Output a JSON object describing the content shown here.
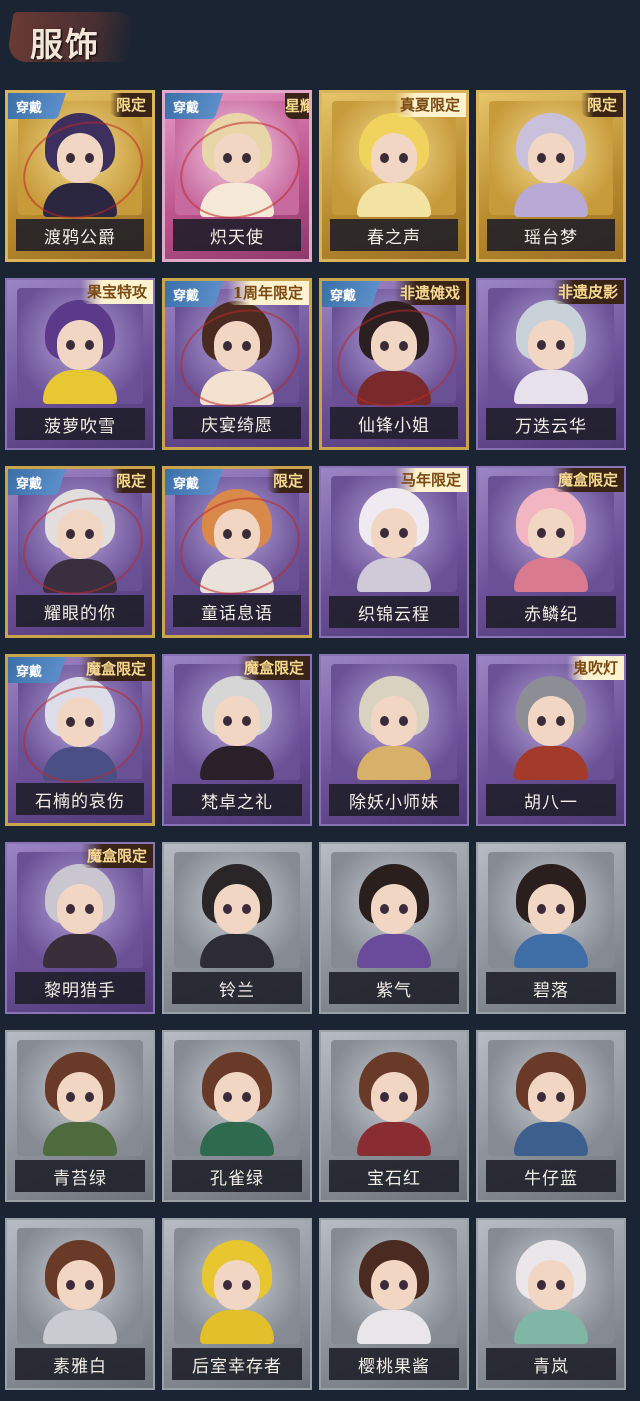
{
  "header": {
    "title": "服饰"
  },
  "badge_text": "穿戴",
  "cards": [
    {
      "name": "渡鸦公爵",
      "rarity": "gold",
      "worn": true,
      "tag": "限定",
      "tag_style": "h",
      "hair": "#3d2f5e",
      "body": "#2b2740"
    },
    {
      "name": "炽天使",
      "rarity": "pink",
      "worn": true,
      "tag": "星耀限定",
      "tag_style": "v",
      "hair": "#e9d6a8",
      "body": "#f6e8d6"
    },
    {
      "name": "春之声",
      "rarity": "gold",
      "worn": false,
      "tag": "真夏限定",
      "tag_style": "light",
      "hair": "#f0d35c",
      "body": "#f3e3a2"
    },
    {
      "name": "瑶台梦",
      "rarity": "gold",
      "worn": false,
      "tag": "限定",
      "tag_style": "h",
      "hair": "#c9c1dc",
      "body": "#b9a9d6"
    },
    {
      "name": "菠萝吹雪",
      "rarity": "purple",
      "worn": false,
      "tag": "果宝特攻",
      "tag_style": "light",
      "hair": "#5b3a8a",
      "body": "#e8c832"
    },
    {
      "name": "庆宴绮愿",
      "rarity": "purple",
      "worn": true,
      "tag": "1周年限定",
      "tag_style": "light",
      "hair": "#4a2b22",
      "body": "#f2e2cf"
    },
    {
      "name": "仙锋小姐",
      "rarity": "purple",
      "worn": true,
      "tag": "非遗傩戏",
      "tag_style": "h",
      "hair": "#2b1f22",
      "body": "#7a2a2a"
    },
    {
      "name": "万迭云华",
      "rarity": "purple",
      "worn": false,
      "tag": "非遗皮影",
      "tag_style": "h",
      "hair": "#c9d2d8",
      "body": "#e6e1ea"
    },
    {
      "name": "耀眼的你",
      "rarity": "purple",
      "worn": true,
      "tag": "限定",
      "tag_style": "h",
      "hair": "#e3dede",
      "body": "#3a2f3f"
    },
    {
      "name": "童话息语",
      "rarity": "purple",
      "worn": true,
      "tag": "限定",
      "tag_style": "h",
      "hair": "#d98a4a",
      "body": "#e9e1da"
    },
    {
      "name": "织锦云程",
      "rarity": "purple",
      "worn": false,
      "tag": "马年限定",
      "tag_style": "light",
      "hair": "#efeaf2",
      "body": "#d0cad8"
    },
    {
      "name": "赤鳞纪",
      "rarity": "purple",
      "worn": false,
      "tag": "魔盒限定",
      "tag_style": "h",
      "hair": "#f2b6c2",
      "body": "#d97a8e"
    },
    {
      "name": "石楠的哀伤",
      "rarity": "purple",
      "worn": true,
      "tag": "魔盒限定",
      "tag_style": "h",
      "hair": "#dcdde8",
      "body": "#4a4f86"
    },
    {
      "name": "梵卓之礼",
      "rarity": "purple",
      "worn": false,
      "tag": "魔盒限定",
      "tag_style": "h",
      "hair": "#d6d6d6",
      "body": "#2b1f2a"
    },
    {
      "name": "除妖小师妹",
      "rarity": "purple",
      "worn": false,
      "tag": "",
      "tag_style": "h",
      "hair": "#d9d2c0",
      "body": "#d7b06a"
    },
    {
      "name": "胡八一",
      "rarity": "purple",
      "worn": false,
      "tag": "鬼吹灯",
      "tag_style": "light",
      "hair": "#8d8d95",
      "body": "#a33a2a"
    },
    {
      "name": "黎明猎手",
      "rarity": "purple",
      "worn": false,
      "tag": "魔盒限定",
      "tag_style": "h",
      "hair": "#c9c6d0",
      "body": "#3a2d3a"
    },
    {
      "name": "铃兰",
      "rarity": "grey",
      "worn": false,
      "tag": "",
      "tag_style": "h",
      "hair": "#2a2526",
      "body": "#2d2b35"
    },
    {
      "name": "紫气",
      "rarity": "grey",
      "worn": false,
      "tag": "",
      "tag_style": "h",
      "hair": "#2a1f1c",
      "body": "#6a4a9a"
    },
    {
      "name": "碧落",
      "rarity": "grey",
      "worn": false,
      "tag": "",
      "tag_style": "h",
      "hair": "#2a1f1c",
      "body": "#3f6ea6"
    },
    {
      "name": "青苔绿",
      "rarity": "grey",
      "worn": false,
      "tag": "",
      "tag_style": "h",
      "hair": "#6a3a28",
      "body": "#4f6b3d"
    },
    {
      "name": "孔雀绿",
      "rarity": "grey",
      "worn": false,
      "tag": "",
      "tag_style": "h",
      "hair": "#6a3a28",
      "body": "#2f6a4f"
    },
    {
      "name": "宝石红",
      "rarity": "grey",
      "worn": false,
      "tag": "",
      "tag_style": "h",
      "hair": "#6a3a28",
      "body": "#8a2d33"
    },
    {
      "name": "牛仔蓝",
      "rarity": "grey",
      "worn": false,
      "tag": "",
      "tag_style": "h",
      "hair": "#6a3a28",
      "body": "#3d5f8e"
    },
    {
      "name": "素雅白",
      "rarity": "grey",
      "worn": false,
      "tag": "",
      "tag_style": "h",
      "hair": "#6a3a28",
      "body": "#c9cbd0"
    },
    {
      "name": "后室幸存者",
      "rarity": "grey",
      "worn": false,
      "tag": "",
      "tag_style": "h",
      "hair": "#e8c630",
      "body": "#e3bf2a"
    },
    {
      "name": "樱桃果酱",
      "rarity": "grey",
      "worn": false,
      "tag": "",
      "tag_style": "h",
      "hair": "#4a2b22",
      "body": "#e9e6ea"
    },
    {
      "name": "青岚",
      "rarity": "grey",
      "worn": false,
      "tag": "",
      "tag_style": "h",
      "hair": "#eae6ea",
      "body": "#7fb6a6"
    }
  ]
}
